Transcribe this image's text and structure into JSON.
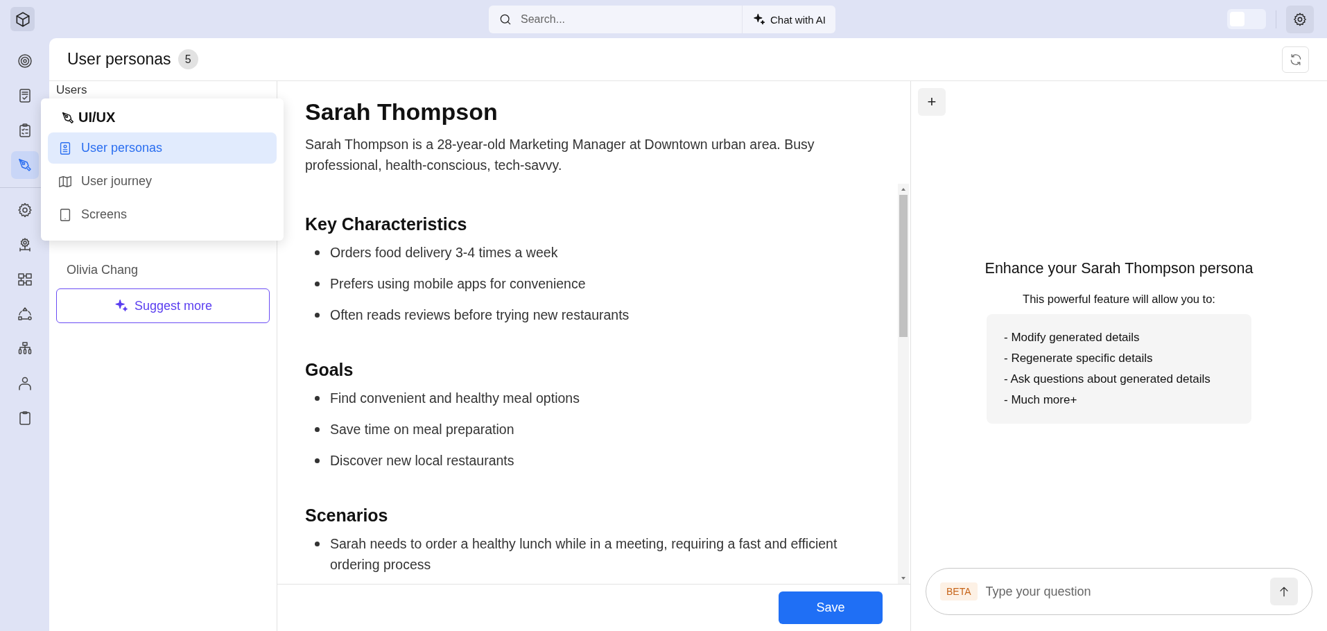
{
  "rail": {
    "primary": [
      {
        "selected": false
      },
      {
        "selected": false
      },
      {
        "selected": false
      },
      {
        "selected": true
      }
    ],
    "secondary": [
      {
        "selected": false
      },
      {
        "selected": false
      },
      {
        "selected": false
      },
      {
        "selected": false
      },
      {
        "selected": false
      },
      {
        "selected": false
      },
      {
        "selected": false
      }
    ]
  },
  "search": {
    "placeholder": "Search..."
  },
  "chat_button": {
    "label": "Chat with AI"
  },
  "theme_toggle": {
    "on": false
  },
  "page_header": {
    "title": "User personas",
    "count": "5"
  },
  "users_panel": {
    "label": "Users",
    "items": [
      {
        "name": "Olivia Chang"
      }
    ],
    "suggest_button": "Suggest more"
  },
  "menu": {
    "title": "UI/UX",
    "items": [
      {
        "label": "User personas",
        "selected": true
      },
      {
        "label": "User journey",
        "selected": false
      },
      {
        "label": "Screens",
        "selected": false
      }
    ]
  },
  "persona": {
    "name": "Sarah Thompson",
    "description": "Sarah Thompson is a 28-year-old Marketing Manager at Downtown urban area. Busy professional, health-conscious, tech-savvy.",
    "sections": [
      {
        "heading": "Key Characteristics",
        "items": [
          "Orders food delivery 3-4 times a week",
          "Prefers using mobile apps for convenience",
          "Often reads reviews before trying new restaurants"
        ]
      },
      {
        "heading": "Goals",
        "items": [
          "Find convenient and healthy meal options",
          "Save time on meal preparation",
          "Discover new local restaurants"
        ]
      },
      {
        "heading": "Scenarios",
        "items": [
          "Sarah needs to order a healthy lunch while in a meeting, requiring a fast and efficient ordering process"
        ]
      }
    ]
  },
  "save_button": "Save",
  "assistant": {
    "add_button": "+",
    "heading": "Enhance your Sarah Thompson persona",
    "intro": "This powerful feature will allow you to:",
    "features": [
      "- Modify generated details",
      "- Regenerate specific details",
      "- Ask questions about generated details",
      "- Much more+"
    ],
    "chat": {
      "badge": "BETA",
      "placeholder": "Type your question"
    }
  }
}
